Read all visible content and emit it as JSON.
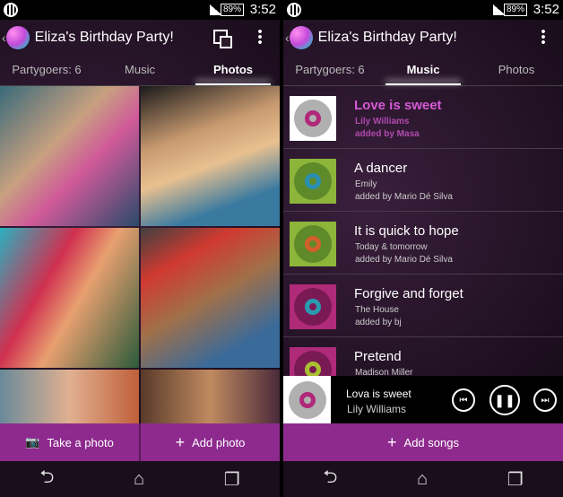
{
  "status": {
    "battery": "89%",
    "time": "3:52"
  },
  "app": {
    "title": "Eliza's Birthday Party!"
  },
  "tabs": [
    "Partygoers: 6",
    "Music",
    "Photos"
  ],
  "left": {
    "active_tab": "Photos",
    "buttons": {
      "take_photo": "Take a photo",
      "add_photo": "Add photo"
    }
  },
  "right": {
    "active_tab": "Music",
    "songs": [
      {
        "title": "Love is sweet",
        "artist": "Lily Williams",
        "added": "added by Masa",
        "bg": "#ffffff",
        "disc": "#b0b0b0",
        "ring": "#b0287a"
      },
      {
        "title": "A dancer",
        "artist": "Emily",
        "added": "added by Mario Dé Silva",
        "bg": "#8db53a",
        "disc": "#5f8a2a",
        "ring": "#2a8fb0"
      },
      {
        "title": "It is quick to hope",
        "artist": "Today & tomorrow",
        "added": "added by Mario Dé Silva",
        "bg": "#8db53a",
        "disc": "#5f8a2a",
        "ring": "#d2602a"
      },
      {
        "title": "Forgive and forget",
        "artist": "The House",
        "added": "added by bj",
        "bg": "#b02a7a",
        "disc": "#7a1a55",
        "ring": "#2a9ab0"
      },
      {
        "title": "Pretend",
        "artist": "Madison Miller",
        "added": "",
        "bg": "#b02a7a",
        "disc": "#7a1a55",
        "ring": "#a8c030"
      }
    ],
    "now_playing": {
      "title": "Lova is sweet",
      "artist": "Lily Williams"
    },
    "add_songs": "Add songs"
  },
  "icons": [
    "globe-icon",
    "signal-icon",
    "battery-icon",
    "back-icon",
    "party-logo",
    "pip-icon",
    "overflow-menu-icon",
    "camera-icon",
    "plus-icon",
    "previous-icon",
    "pause-icon",
    "next-icon",
    "nav-back-icon",
    "home-icon",
    "recents-icon"
  ],
  "colors": {
    "accent": "#8e2a8e",
    "highlight": "#d65ad6"
  }
}
